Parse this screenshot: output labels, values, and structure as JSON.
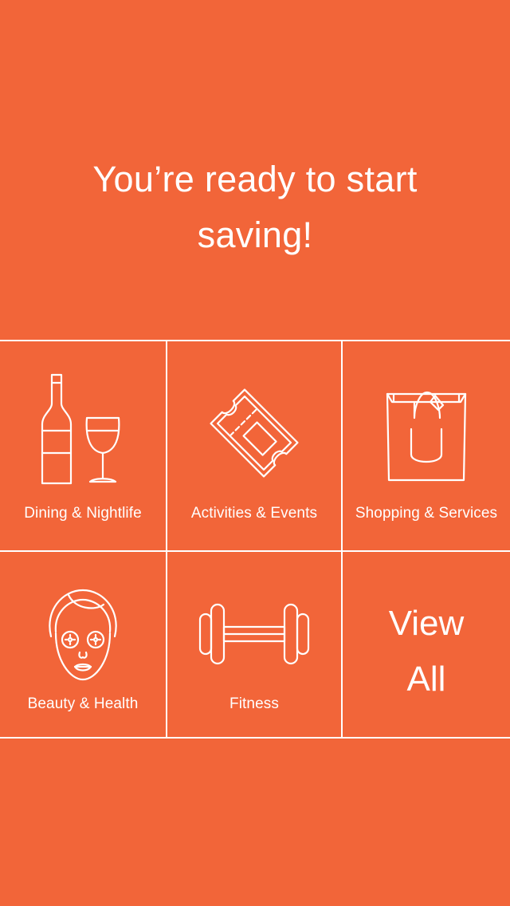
{
  "colors": {
    "background": "#F26539",
    "foreground": "#FFFFFF"
  },
  "headline": {
    "line1": "You’re ready to start",
    "line2": "saving!"
  },
  "categories": [
    {
      "label": "Dining & Nightlife",
      "icon": "wine-bottle-and-glass-icon"
    },
    {
      "label": "Activities & Events",
      "icon": "ticket-icon"
    },
    {
      "label": "Shopping & Services",
      "icon": "shopping-bag-icon"
    },
    {
      "label": "Beauty & Health",
      "icon": "face-mask-icon"
    },
    {
      "label": "Fitness",
      "icon": "dumbbell-icon"
    }
  ],
  "view_all": {
    "line1": "View",
    "line2": "All"
  }
}
